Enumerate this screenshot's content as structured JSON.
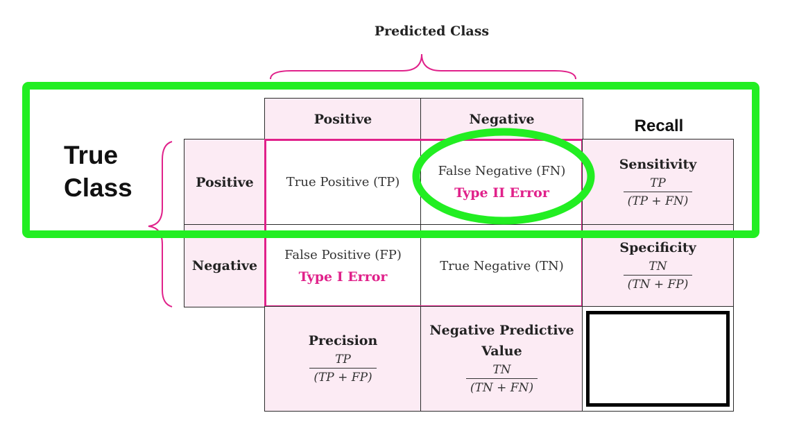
{
  "predicted_class_label": "Predicted Class",
  "true_class_label_line1": "True",
  "true_class_label_line2": "Class",
  "recall_label": "Recall",
  "col_headers": {
    "positive": "Positive",
    "negative": "Negative"
  },
  "row_headers": {
    "positive": "Positive",
    "negative": "Negative"
  },
  "cells": {
    "tp": "True Positive (TP)",
    "fn": "False Negative (FN)",
    "fn_error": "Type II Error",
    "fp": "False Positive (FP)",
    "fp_error": "Type I Error",
    "tn": "True Negative (TN)"
  },
  "metrics": {
    "sensitivity": {
      "title": "Sensitivity",
      "num": "TP",
      "den": "(TP + FN)"
    },
    "specificity": {
      "title": "Specificity",
      "num": "TN",
      "den": "(TN + FP)"
    },
    "precision": {
      "title": "Precision",
      "num": "TP",
      "den": "(TP + FP)"
    },
    "npv": {
      "title_line1": "Negative Predictive",
      "title_line2": "Value",
      "num": "TN",
      "den": "(TN + FN)"
    }
  },
  "colors": {
    "accent_pink": "#e0218a",
    "cell_pink": "#fcebf4",
    "highlight_green": "#22ee22"
  }
}
